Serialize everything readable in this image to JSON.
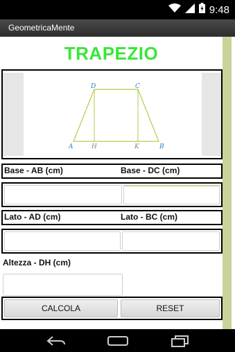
{
  "status_bar": {
    "time": "9:48"
  },
  "app": {
    "title": "GeometricaMente"
  },
  "heading": "TRAPEZIO",
  "figure": {
    "vertices": [
      "A",
      "B",
      "C",
      "D"
    ],
    "height_feet": [
      "H",
      "K"
    ],
    "colors": {
      "shape": "#b7c94a",
      "labels": "#2a7fbf"
    }
  },
  "form": {
    "base_ab_label": "Base - AB (cm)",
    "base_dc_label": "Base - DC (cm)",
    "lato_ad_label": "Lato - AD (cm)",
    "lato_bc_label": "Lato - BC (cm)",
    "altezza_label": "Altezza - DH (cm)",
    "base_ab_value": "",
    "base_dc_value": "",
    "lato_ad_value": "",
    "lato_bc_value": "",
    "altezza_value": ""
  },
  "buttons": {
    "calcola": "CALCOLA",
    "reset": "RESET"
  },
  "colors": {
    "heading": "#39e639",
    "scrollbar": "#c8d49a"
  },
  "icons": [
    "wifi-icon",
    "signal-icon",
    "battery-icon",
    "back-icon",
    "home-icon",
    "recents-icon"
  ]
}
